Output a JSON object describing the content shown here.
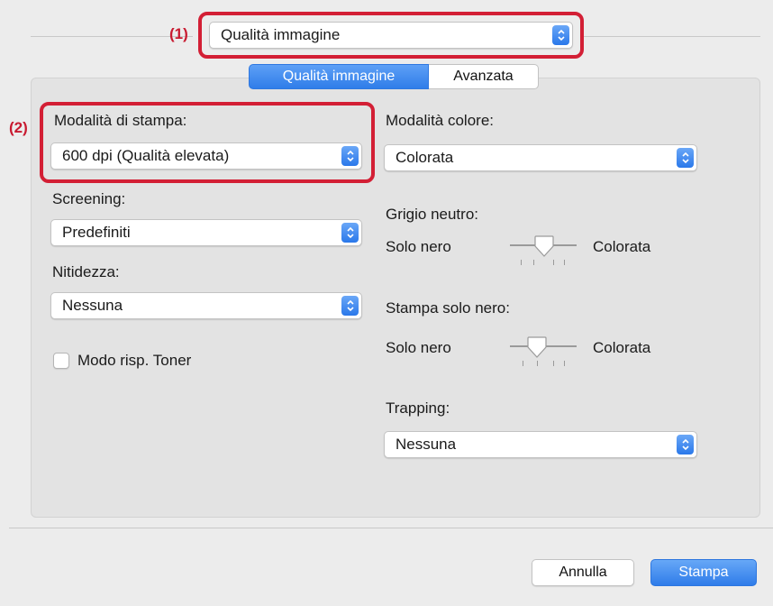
{
  "header": {
    "marker_1": "(1)",
    "panel_select": "Qualità immagine"
  },
  "tabs": [
    {
      "label": "Qualità immagine",
      "active": true
    },
    {
      "label": "Avanzata",
      "active": false
    }
  ],
  "left": {
    "marker_2": "(2)",
    "print_mode_label": "Modalità di stampa:",
    "print_mode_value": "600 dpi (Qualità elevata)",
    "screening_label": "Screening:",
    "screening_value": "Predefiniti",
    "sharpness_label": "Nitidezza:",
    "sharpness_value": "Nessuna",
    "toner_save_label": "Modo risp. Toner",
    "toner_save_checked": false
  },
  "right": {
    "color_mode_label": "Modalità colore:",
    "color_mode_value": "Colorata",
    "neutral_gray_label": "Grigio neutro:",
    "neutral_gray_min": "Solo nero",
    "neutral_gray_max": "Colorata",
    "black_only_label": "Stampa solo nero:",
    "black_only_min": "Solo nero",
    "black_only_max": "Colorata",
    "trapping_label": "Trapping:",
    "trapping_value": "Nessuna"
  },
  "footer": {
    "cancel_label": "Annulla",
    "print_label": "Stampa"
  },
  "colors": {
    "accent": "#2f7de9",
    "annotation": "#d31f35"
  }
}
